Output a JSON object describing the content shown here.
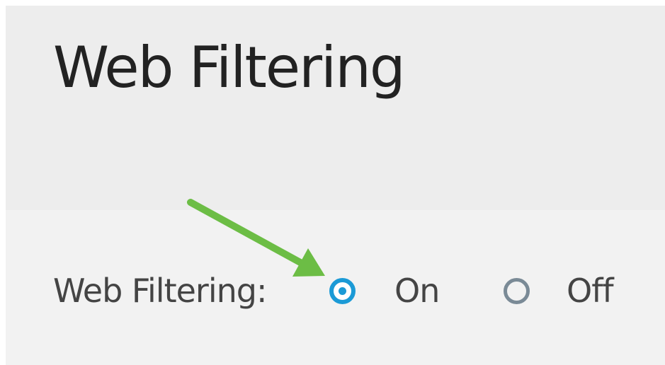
{
  "header": {
    "title": "Web Filtering"
  },
  "form": {
    "web_filtering": {
      "label": "Web Filtering:",
      "options": [
        {
          "label": "On",
          "selected": true
        },
        {
          "label": "Off",
          "selected": false
        }
      ]
    }
  },
  "annotation": {
    "icon": "arrow-icon",
    "color": "#6cbd45"
  },
  "colors": {
    "radio_selected": "#1b9ad6",
    "radio_unselected": "#7a8a96",
    "header_bg": "#ededed",
    "content_bg": "#f2f2f2"
  }
}
